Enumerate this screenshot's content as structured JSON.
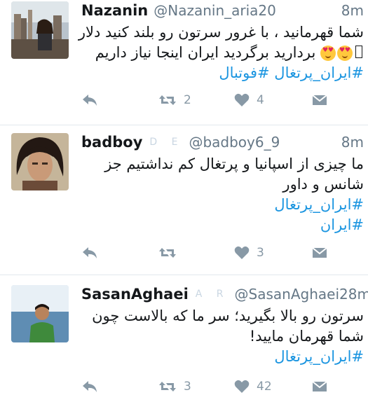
{
  "tweets": [
    {
      "name": "Nazanin",
      "handle": "@Nazanin_aria20",
      "badges": "",
      "time": "8m",
      "lines": [
        "شما قهرمانید ، با غرور سرتون رو بلند کنید دلار",
        "بردارید برگردید ایران اینجا نیاز داریم"
      ],
      "hashtags": [
        "#ایران_پرتغال #فوتبال"
      ],
      "retweets": "2",
      "likes": "4",
      "avatar_icon": "user-photo-city"
    },
    {
      "name": "badboy",
      "handle": "@badboy6_9",
      "badges": "D E",
      "time": "8m",
      "lines": [
        "ما چیزی از اسپانیا و پرتغال کم نداشتیم جز",
        "شانس و داور"
      ],
      "hashtags": [
        "#ایران_پرتغال",
        "#ایران"
      ],
      "retweets": "",
      "likes": "3",
      "avatar_icon": "user-photo-portrait"
    },
    {
      "name": "SasanAghaei",
      "handle": "@SasanAghaei2",
      "badges": "A R",
      "time": "8m",
      "lines": [
        "سرتون رو بالا بگیرید؛ سر ما که بالاست چون",
        "شما قهرمان مایید!"
      ],
      "hashtags": [
        "#ایران_پرتغال"
      ],
      "retweets": "3",
      "likes": "42",
      "avatar_icon": "user-photo-sea"
    }
  ],
  "colors": {
    "hashtag": "#1b95e0",
    "muted": "#657786",
    "action_icon": "#8899a6",
    "separator": "#e1e8ed"
  }
}
